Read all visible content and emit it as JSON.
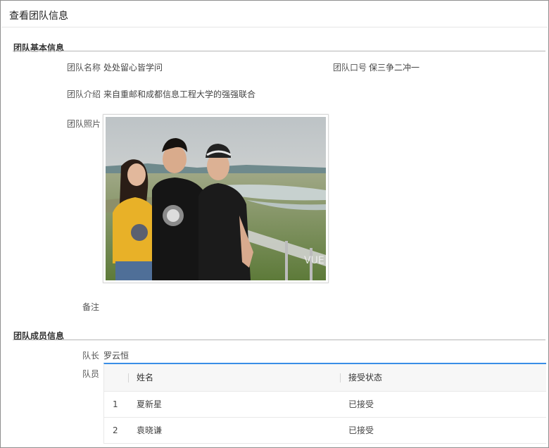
{
  "page": {
    "title": "查看团队信息"
  },
  "basic_section": {
    "title": "团队基本信息",
    "name_label": "团队名称",
    "name_value": "处处留心皆学问",
    "slogan_label": "团队口号",
    "slogan_value": "保三争二冲一",
    "intro_label": "团队介绍",
    "intro_value": "来自重邮和成都信息工程大学的强强联合",
    "photo_label": "团队照片",
    "remark_label": "备注",
    "remark_value": ""
  },
  "members_section": {
    "title": "团队成员信息",
    "leader_label": "队长",
    "leader_value": "罗云恒",
    "members_label": "队员",
    "table": {
      "columns": [
        "",
        "姓名",
        "接受状态"
      ],
      "rows": [
        {
          "index": "1",
          "name": "夏新星",
          "status": "已接受"
        },
        {
          "index": "2",
          "name": "袁晓谦",
          "status": "已接受"
        }
      ]
    }
  }
}
